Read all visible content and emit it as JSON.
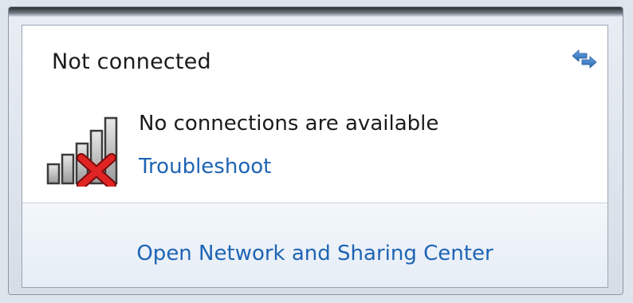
{
  "network_flyout": {
    "status_title": "Not connected",
    "refresh_icon": "refresh-icon",
    "signal_icon": "no-signal-bars-red-x-icon",
    "message": "No connections are available",
    "troubleshoot_label": "Troubleshoot",
    "footer_link_label": "Open Network and Sharing Center"
  },
  "colors": {
    "link": "#1e64b4",
    "error_x": "#d81e1e",
    "text": "#1b1b1b"
  }
}
